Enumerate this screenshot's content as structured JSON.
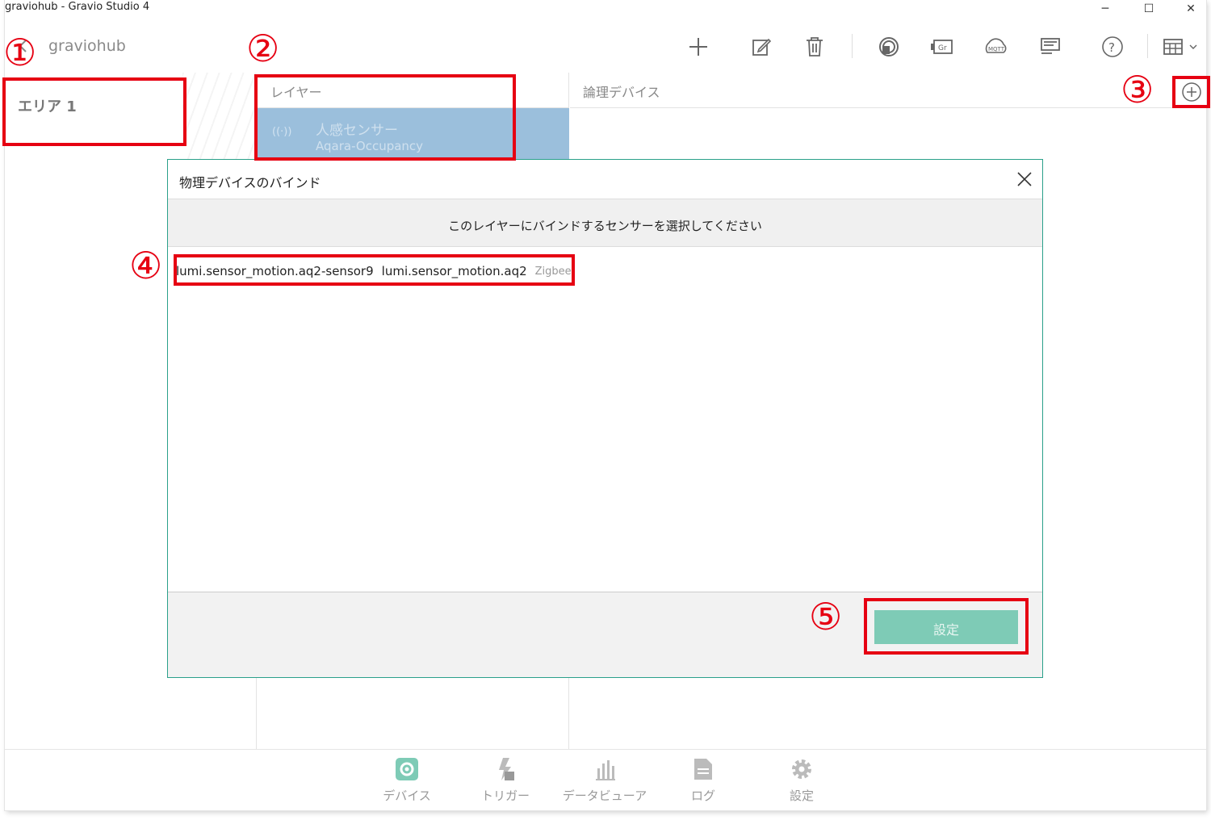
{
  "window": {
    "title": "graviohub - Gravio Studio 4"
  },
  "window_controls": {
    "minimize": "─",
    "maximize": "☐",
    "close": "✕"
  },
  "toolbar": {
    "hub_name": "graviohub",
    "icons": [
      "add-icon",
      "edit-icon",
      "delete-icon",
      "sensor-icon",
      "camera-icon",
      "mqtt-icon",
      "list-icon",
      "help-icon",
      "layout-icon"
    ],
    "mqtt_label": "MQTT",
    "camera_label": "Gr"
  },
  "areas": {
    "items": [
      {
        "label": "エリア 1"
      }
    ]
  },
  "layers": {
    "header": "レイヤー",
    "items": [
      {
        "name": "人感センサー",
        "type": "Aqara-Occupancy",
        "icon": "((·))"
      }
    ]
  },
  "logical_devices": {
    "header": "論理デバイス"
  },
  "bottom_nav": {
    "items": [
      {
        "label": "デバイス",
        "icon": "gear-icon",
        "active": true
      },
      {
        "label": "トリガー",
        "icon": "trigger-icon"
      },
      {
        "label": "データビューア",
        "icon": "bar-chart-icon"
      },
      {
        "label": "ログ",
        "icon": "document-icon"
      },
      {
        "label": "設定",
        "icon": "settings-icon"
      }
    ]
  },
  "modal": {
    "title": "物理デバイスのバインド",
    "subtitle": "このレイヤーにバインドするセンサーを選択してください",
    "devices": [
      {
        "id": "lumi.sensor_motion.aq2-sensor9",
        "model": "lumi.sensor_motion.aq2",
        "protocol": "Zigbee"
      }
    ],
    "submit_label": "設定"
  },
  "annotations": {
    "badges": [
      "①",
      "②",
      "③",
      "④",
      "⑤"
    ]
  },
  "colors": {
    "accent": "#7ecbb6",
    "highlight": "#e60012",
    "layer_selected": "#9bbfdc",
    "modal_border": "#2aa08a"
  }
}
